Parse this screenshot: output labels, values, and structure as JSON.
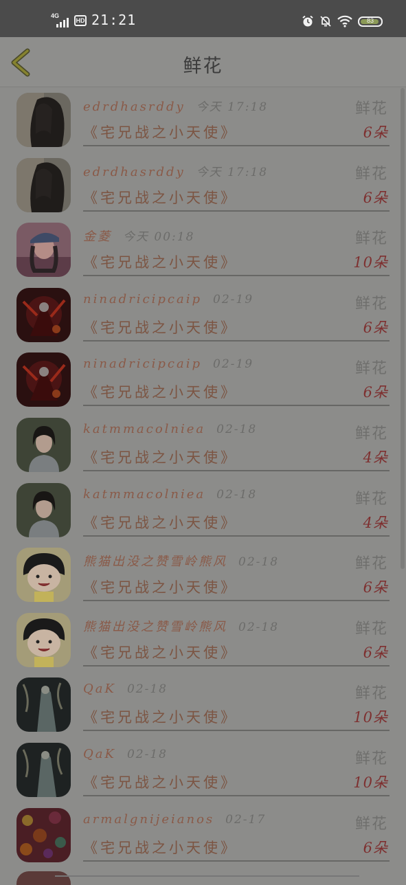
{
  "status_bar": {
    "network": "4G",
    "hd": "HD",
    "time": "21:21",
    "battery": "83",
    "icons": [
      "signal-icon",
      "hd-icon",
      "alarm-icon",
      "bell-off-icon",
      "wifi-icon",
      "battery-icon"
    ]
  },
  "header": {
    "back_icon": "chevron-left-icon",
    "title": "鲜花"
  },
  "rows": [
    {
      "user": "edrdhasrddy",
      "time": "今天 17:18",
      "type": "鲜花",
      "book": "《宅兄战之小天使》",
      "count": "6朵",
      "avatar": "portrait-long-hair"
    },
    {
      "user": "edrdhasrddy",
      "time": "今天 17:18",
      "type": "鲜花",
      "book": "《宅兄战之小天使》",
      "count": "6朵",
      "avatar": "portrait-long-hair"
    },
    {
      "user": "金菱",
      "time": "今天 00:18",
      "type": "鲜花",
      "book": "《宅兄战之小天使》",
      "count": "10朵",
      "avatar": "portrait-cap"
    },
    {
      "user": "ninadricipcaip",
      "time": "02-19",
      "type": "鲜花",
      "book": "《宅兄战之小天使》",
      "count": "6朵",
      "avatar": "dark-warrior"
    },
    {
      "user": "ninadricipcaip",
      "time": "02-19",
      "type": "鲜花",
      "book": "《宅兄战之小天使》",
      "count": "6朵",
      "avatar": "dark-warrior"
    },
    {
      "user": "katmmacolniea",
      "time": "02-18",
      "type": "鲜花",
      "book": "《宅兄战之小天使》",
      "count": "4朵",
      "avatar": "portrait-girl"
    },
    {
      "user": "katmmacolniea",
      "time": "02-18",
      "type": "鲜花",
      "book": "《宅兄战之小天使》",
      "count": "4朵",
      "avatar": "portrait-girl"
    },
    {
      "user": "熊猫出没之赞雪岭熊风",
      "time": "02-18",
      "type": "鲜花",
      "book": "《宅兄战之小天使》",
      "count": "6朵",
      "avatar": "cartoon-girl"
    },
    {
      "user": "熊猫出没之赞雪岭熊风",
      "time": "02-18",
      "type": "鲜花",
      "book": "《宅兄战之小天使》",
      "count": "6朵",
      "avatar": "cartoon-girl"
    },
    {
      "user": "QaK",
      "time": "02-18",
      "type": "鲜花",
      "book": "《宅兄战之小天使》",
      "count": "10朵",
      "avatar": "ink-figure"
    },
    {
      "user": "QaK",
      "time": "02-18",
      "type": "鲜花",
      "book": "《宅兄战之小天使》",
      "count": "10朵",
      "avatar": "ink-figure"
    },
    {
      "user": "armalgnijeianos",
      "time": "02-17",
      "type": "鲜花",
      "book": "《宅兄战之小天使》",
      "count": "6朵",
      "avatar": "bokeh-lights"
    }
  ]
}
